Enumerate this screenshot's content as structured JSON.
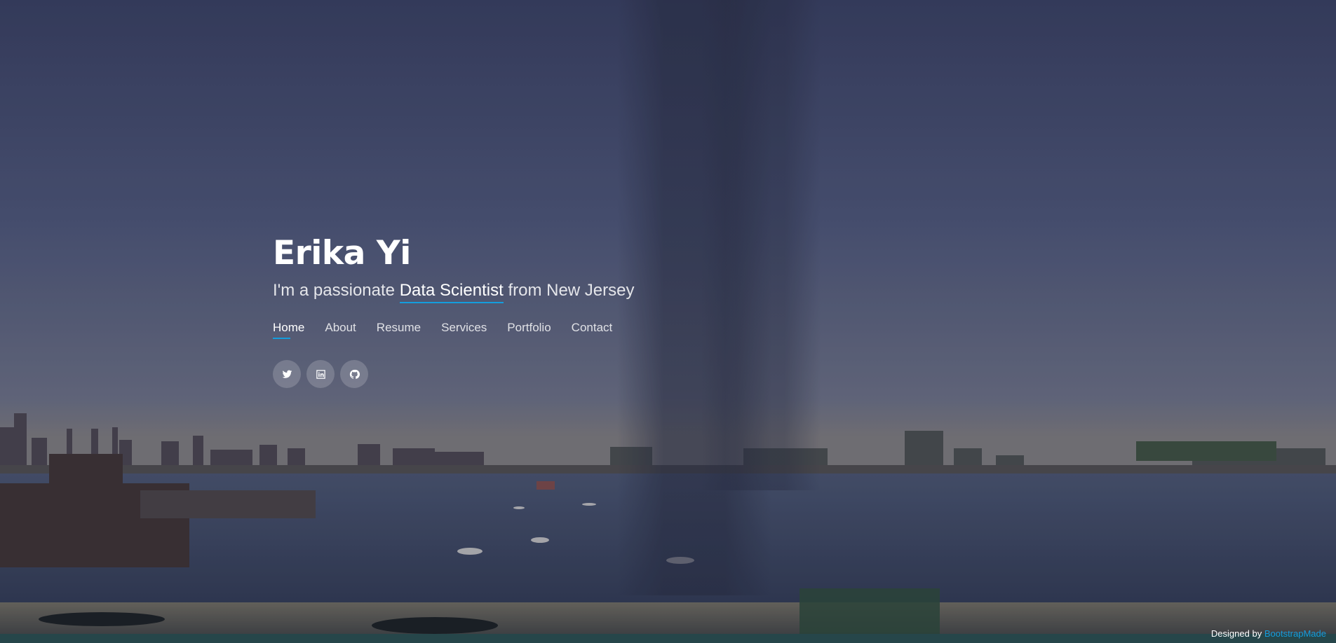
{
  "hero": {
    "name": "Erika Yi",
    "tagline_prefix": "I'm a passionate",
    "tagline_highlight": "Data Scientist",
    "tagline_suffix": "from New Jersey"
  },
  "nav": {
    "items": [
      {
        "label": "Home",
        "active": true
      },
      {
        "label": "About"
      },
      {
        "label": "Resume"
      },
      {
        "label": "Services"
      },
      {
        "label": "Portfolio"
      },
      {
        "label": "Contact"
      }
    ]
  },
  "social": {
    "items": [
      {
        "icon": "twitter-icon"
      },
      {
        "icon": "linkedin-icon"
      },
      {
        "icon": "github-icon"
      }
    ]
  },
  "credits": {
    "prefix": "Designed by",
    "link": "BootstrapMade"
  },
  "colors": {
    "accent": "#149ddd",
    "text": "#ffffff"
  }
}
